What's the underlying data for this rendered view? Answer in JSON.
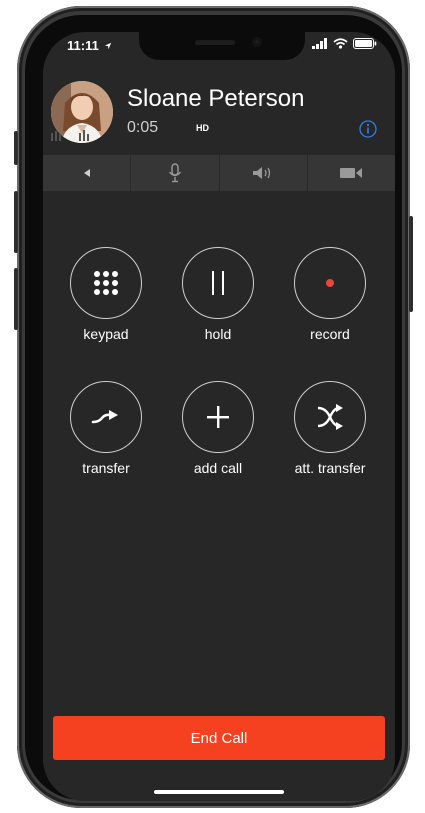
{
  "status_bar": {
    "time": "11:11"
  },
  "call": {
    "caller_name": "Sloane Peterson",
    "duration": "0:05",
    "quality_badge": "HD"
  },
  "toolbar": {
    "items": [
      {
        "icon": "back-arrow-icon"
      },
      {
        "icon": "microphone-icon"
      },
      {
        "icon": "speaker-icon"
      },
      {
        "icon": "video-camera-icon"
      }
    ]
  },
  "actions": [
    {
      "label": "keypad",
      "icon": "keypad-icon"
    },
    {
      "label": "hold",
      "icon": "pause-icon"
    },
    {
      "label": "record",
      "icon": "record-icon"
    },
    {
      "label": "transfer",
      "icon": "transfer-icon"
    },
    {
      "label": "add call",
      "icon": "plus-icon"
    },
    {
      "label": "att. transfer",
      "icon": "attended-transfer-icon"
    }
  ],
  "end_call_label": "End Call",
  "colors": {
    "end_call": "#f5411f",
    "screen_bg": "#272727",
    "toolbar_bg": "#363636",
    "info_accent": "#2f7fe0",
    "record_dot": "#e8473a"
  }
}
